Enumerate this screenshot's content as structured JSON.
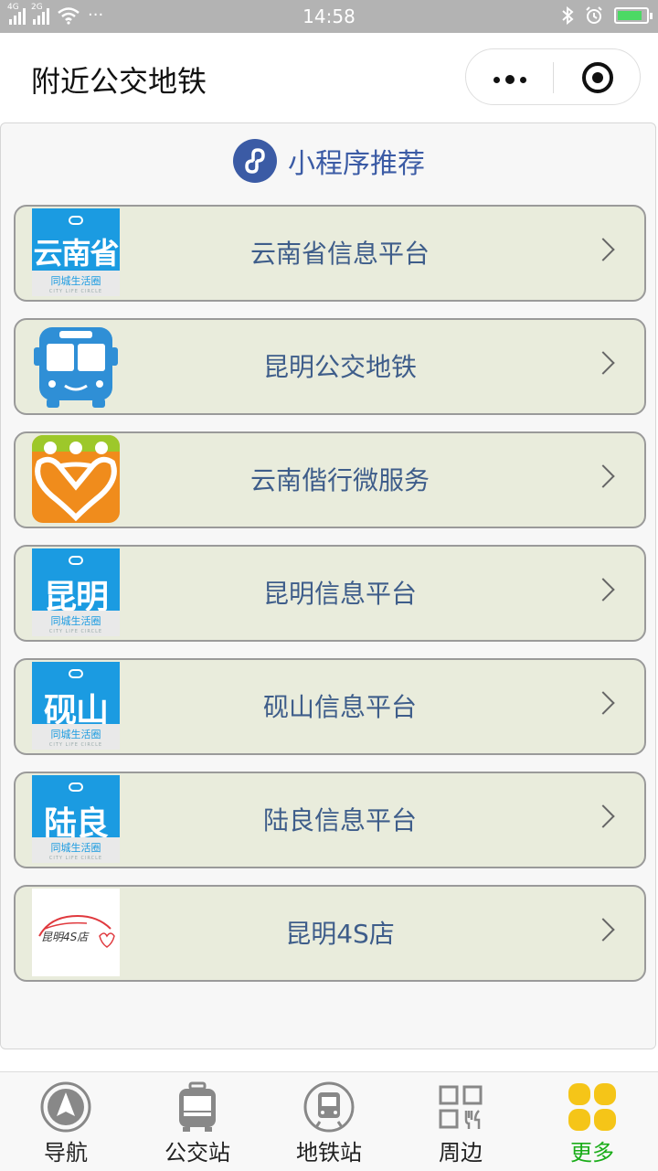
{
  "status_bar": {
    "net1": "4G",
    "net2": "2G",
    "more": "···",
    "time": "14:58"
  },
  "header": {
    "title": "附近公交地铁"
  },
  "section": {
    "title": "小程序推荐"
  },
  "items": [
    {
      "label": "云南省信息平台",
      "icon_text": "云南省",
      "icon_footer": "同城生活圈",
      "icon_footer_en": "CITY LIFE CIRCLE",
      "icon": "city-life-icon"
    },
    {
      "label": "昆明公交地铁",
      "icon": "bus-icon"
    },
    {
      "label": "云南偕行微服务",
      "icon": "service-logo-icon"
    },
    {
      "label": "昆明信息平台",
      "icon_text": "昆明",
      "icon_footer": "同城生活圈",
      "icon_footer_en": "CITY LIFE CIRCLE",
      "icon": "city-life-icon"
    },
    {
      "label": "砚山信息平台",
      "icon_text": "砚山",
      "icon_footer": "同城生活圈",
      "icon_footer_en": "CITY LIFE CIRCLE",
      "icon": "city-life-icon"
    },
    {
      "label": "陆良信息平台",
      "icon_text": "陆良",
      "icon_footer": "同城生活圈",
      "icon_footer_en": "CITY LIFE CIRCLE",
      "icon": "city-life-icon"
    },
    {
      "label": "昆明4S店",
      "icon_text": "昆明4S店",
      "icon": "car-shop-icon"
    }
  ],
  "tabs": [
    {
      "label": "导航",
      "icon": "compass-icon",
      "active": false
    },
    {
      "label": "公交站",
      "icon": "bus-stop-icon",
      "active": false
    },
    {
      "label": "地铁站",
      "icon": "subway-icon",
      "active": false
    },
    {
      "label": "周边",
      "icon": "nearby-grid-icon",
      "active": false
    },
    {
      "label": "更多",
      "icon": "more-grid-icon",
      "active": true
    }
  ],
  "colors": {
    "accent": "#3b5ba5",
    "active_tab": "#1aad19",
    "item_bg": "#e9ecdc",
    "city_icon_blue": "#1b9be1",
    "tab_icon_active": "#f5c518"
  }
}
